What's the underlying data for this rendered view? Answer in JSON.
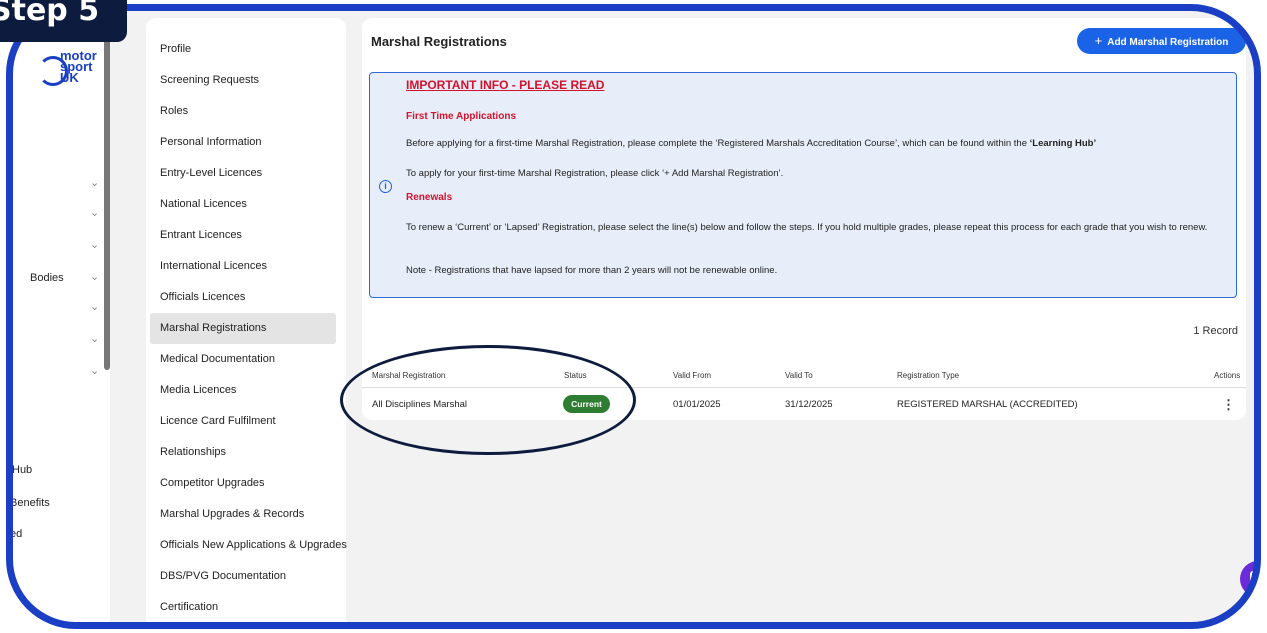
{
  "step_badge": "Step 5",
  "logo": {
    "line1": "motor",
    "line2": "sport",
    "line3": "UK"
  },
  "colors": {
    "accent": "#1b63e6",
    "frame": "#1b3fc4",
    "alert": "#d3122d",
    "status_current": "#2e7d32",
    "info_bg": "#e7eef9"
  },
  "rail": {
    "labels": [
      "Bodies",
      "Hub",
      "Benefits",
      "ed"
    ]
  },
  "menu": {
    "items": [
      "Profile",
      "Screening Requests",
      "Roles",
      "Personal Information",
      "Entry-Level Licences",
      "National Licences",
      "Entrant Licences",
      "International Licences",
      "Officials Licences",
      "Marshal Registrations",
      "Medical Documentation",
      "Media Licences",
      "Licence Card Fulfilment",
      "Relationships",
      "Competitor Upgrades",
      "Marshal Upgrades & Records",
      "Officials New Applications & Upgrades",
      "DBS/PVG Documentation",
      "Certification"
    ],
    "active": "Marshal Registrations"
  },
  "main": {
    "title": "Marshal Registrations",
    "add_button": "Add Marshal Registration",
    "info": {
      "heading": "IMPORTANT INFO - PLEASE READ",
      "first_time_title": "First Time Applications",
      "first_time_text": "Before applying for a first-time Marshal Registration, please complete the ‘Registered Marshals Accreditation Course’, which can be found within the ",
      "first_time_link": "‘Learning Hub’",
      "apply_text": "To apply for your first-time Marshal Registration, please click ‘+ Add Marshal Registration’.",
      "renewals_title": "Renewals",
      "renewals_text": "To renew a ‘Current’ or ‘Lapsed’ Registration, please select the line(s) below and follow the steps. If you hold multiple grades, please repeat this process for each grade that you wish to renew.",
      "note_text": "Note - Registrations that have lapsed for more than 2 years will not be renewable online."
    },
    "records_count": "1 Record",
    "table": {
      "headers": [
        "Marshal Registration",
        "Status",
        "Valid From",
        "Valid To",
        "Registration Type",
        "Actions"
      ],
      "rows": [
        {
          "registration": "All Disciplines Marshal",
          "status": "Current",
          "valid_from": "01/01/2025",
          "valid_to": "31/12/2025",
          "type": "REGISTERED MARSHAL (ACCREDITED)"
        }
      ]
    }
  }
}
